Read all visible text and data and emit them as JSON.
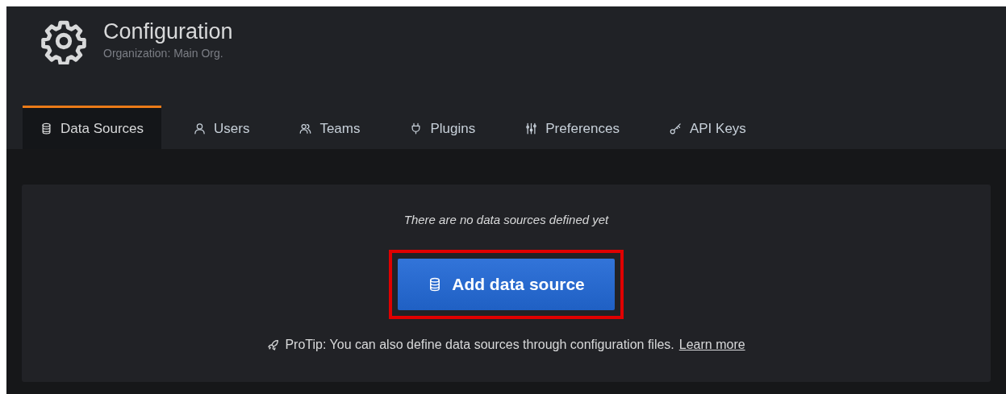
{
  "header": {
    "title": "Configuration",
    "subtitle": "Organization: Main Org."
  },
  "tabs": [
    {
      "label": "Data Sources",
      "selected": true
    },
    {
      "label": "Users",
      "selected": false
    },
    {
      "label": "Teams",
      "selected": false
    },
    {
      "label": "Plugins",
      "selected": false
    },
    {
      "label": "Preferences",
      "selected": false
    },
    {
      "label": "API Keys",
      "selected": false
    }
  ],
  "empty_state": {
    "message": "There are no data sources defined yet",
    "button": {
      "label": "Add data source",
      "highlighted": true
    },
    "protip": "ProTip: You can also define data sources through configuration files.",
    "link": "Learn more"
  }
}
